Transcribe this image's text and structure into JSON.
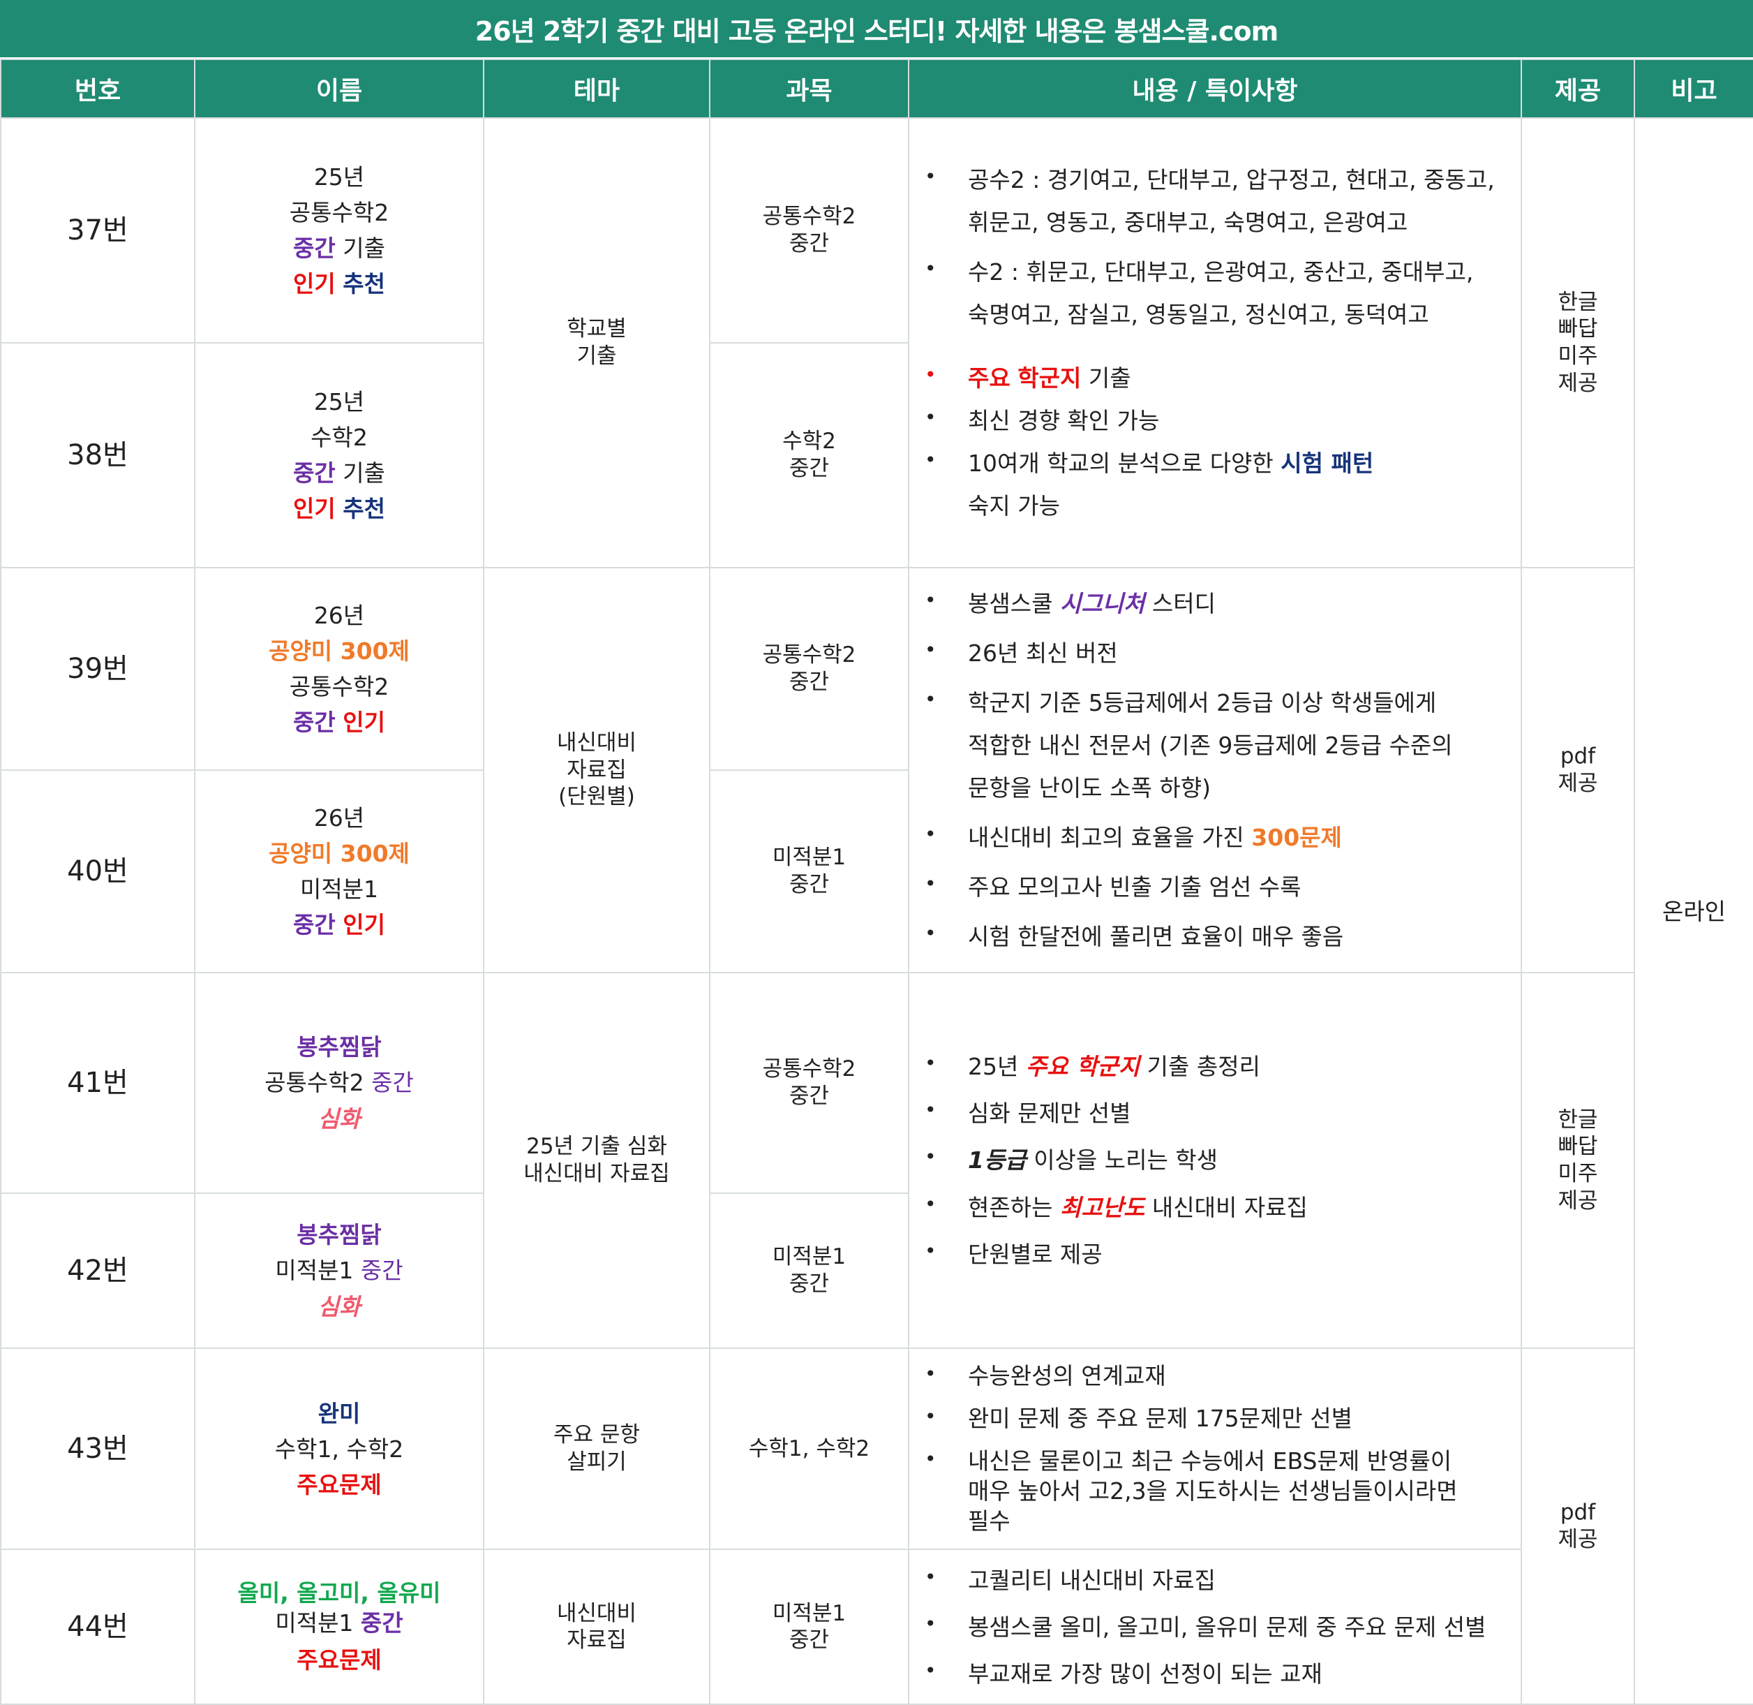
{
  "banner": "26년 2학기 중간 대비 고등 온라인 스터디! 자세한 내용은 봉샘스쿨.com",
  "headers": {
    "num": "번호",
    "name": "이름",
    "theme": "테마",
    "subject": "과목",
    "content": "내용 / 특이사항",
    "provide": "제공",
    "note": "비고"
  },
  "rows": {
    "r37": {
      "num": "37번",
      "name": [
        "25년",
        "공통수학2",
        "중간",
        "기출",
        "인기",
        "추천"
      ],
      "subject": [
        "공통수학2",
        "중간"
      ]
    },
    "r38": {
      "num": "38번",
      "name": [
        "25년",
        "수학2",
        "중간",
        "기출",
        "인기",
        "추천"
      ],
      "subject": [
        "수학2",
        "중간"
      ]
    },
    "r39": {
      "num": "39번",
      "name": [
        "26년",
        "공양미 300제",
        "공통수학2",
        "중간",
        "인기"
      ],
      "subject": [
        "공통수학2",
        "중간"
      ]
    },
    "r40": {
      "num": "40번",
      "name": [
        "26년",
        "공양미 300제",
        "미적분1",
        "중간",
        "인기"
      ],
      "subject": [
        "미적분1",
        "중간"
      ]
    },
    "r41": {
      "num": "41번",
      "name": [
        "봉추찜닭",
        "공통수학2",
        "중간",
        "심화"
      ],
      "subject": [
        "공통수학2",
        "중간"
      ]
    },
    "r42": {
      "num": "42번",
      "name": [
        "봉추찜닭",
        "미적분1",
        "중간",
        "심화"
      ],
      "subject": [
        "미적분1",
        "중간"
      ]
    },
    "r43": {
      "num": "43번",
      "name": [
        "완미",
        "수학1, 수학2",
        "주요문제"
      ],
      "subject": "수학1, 수학2"
    },
    "r44": {
      "num": "44번",
      "name": [
        "올미, 올고미, 올유미",
        "미적분1",
        "중간",
        "주요문제"
      ],
      "subject": [
        "미적분1",
        "중간"
      ]
    }
  },
  "themes": {
    "t1": [
      "학교별",
      "기출"
    ],
    "t2": [
      "내신대비",
      "자료집",
      "(단원별)"
    ],
    "t3": [
      "25년 기출 심화",
      "내신대비 자료집"
    ],
    "t4": [
      "주요 문항",
      "살피기"
    ],
    "t5": [
      "내신대비",
      "자료집"
    ]
  },
  "content": {
    "c1": {
      "i1a": "공수2 : 경기여고, 단대부고, 압구정고, 현대고, 중동고,",
      "i1b": "휘문고, 영동고, 중대부고, 숙명여고, 은광여고",
      "i2a": "수2 : 휘문고, 단대부고, 은광여고, 중산고, 중대부고,",
      "i2b": "숙명여고, 잠실고, 영동일고, 정신여고, 동덕여고",
      "i3_hl1": "주요",
      "i3_hl2": "학군지",
      "i3_rest": "기출",
      "i4": "최신 경향 확인 가능",
      "i5_pre": "10여개 학교의 분석으로 다양한",
      "i5_hl": "시험 패턴",
      "i5_next": "숙지 가능"
    },
    "c2": {
      "i1_pre": "봉샘스쿨",
      "i1_hl": "시그니처",
      "i1_post": "스터디",
      "i2": "26년 최신 버전",
      "i3a": "학군지 기준 5등급제에서 2등급 이상 학생들에게",
      "i3b": "적합한 내신 전문서 (기존 9등급제에 2등급 수준의",
      "i3c": "문항을 난이도 소폭 하향)",
      "i4_pre": "내신대비 최고의 효율을 가진",
      "i4_hl": "300문제",
      "i5": "주요 모의고사 빈출 기출 엄선 수록",
      "i6": "시험 한달전에 풀리면 효율이 매우 좋음"
    },
    "c3": {
      "i1_pre": "25년",
      "i1_hl": "주요 학군지",
      "i1_post": "기출 총정리",
      "i2": "심화 문제만 선별",
      "i3_hl": "1등급",
      "i3_post": "이상을 노리는 학생",
      "i4_pre": "현존하는",
      "i4_hl": "최고난도",
      "i4_post": "내신대비 자료집",
      "i5": "단원별로 제공"
    },
    "c4": {
      "i1": "수능완성의 연계교재",
      "i2": "완미 문제 중 주요 문제 175문제만 선별",
      "i3a": "내신은 물론이고 최근 수능에서 EBS문제 반영률이",
      "i3b": "매우 높아서 고2,3을 지도하시는 선생님들이시라면",
      "i3c": "필수"
    },
    "c5": {
      "i1": "고퀄리티 내신대비 자료집",
      "i2": "봉샘스쿨 올미, 올고미, 올유미 문제 중 주요 문제 선별",
      "i3": "부교재로 가장 많이 선정이 되는 교재"
    }
  },
  "provide": {
    "p1": [
      "한글",
      "빠답",
      "미주",
      "제공"
    ],
    "p2": [
      "pdf",
      "제공"
    ],
    "p3": [
      "한글",
      "빠답",
      "미주",
      "제공"
    ],
    "p4": [
      "pdf",
      "제공"
    ]
  },
  "note": "온라인",
  "colors": {
    "header_bg": "#1f8b73",
    "purple": "#6b2fa6",
    "red": "#e81010",
    "navy": "#16337a",
    "orange": "#f07a2a",
    "pink": "#f05a6e",
    "green": "#12a84f"
  }
}
